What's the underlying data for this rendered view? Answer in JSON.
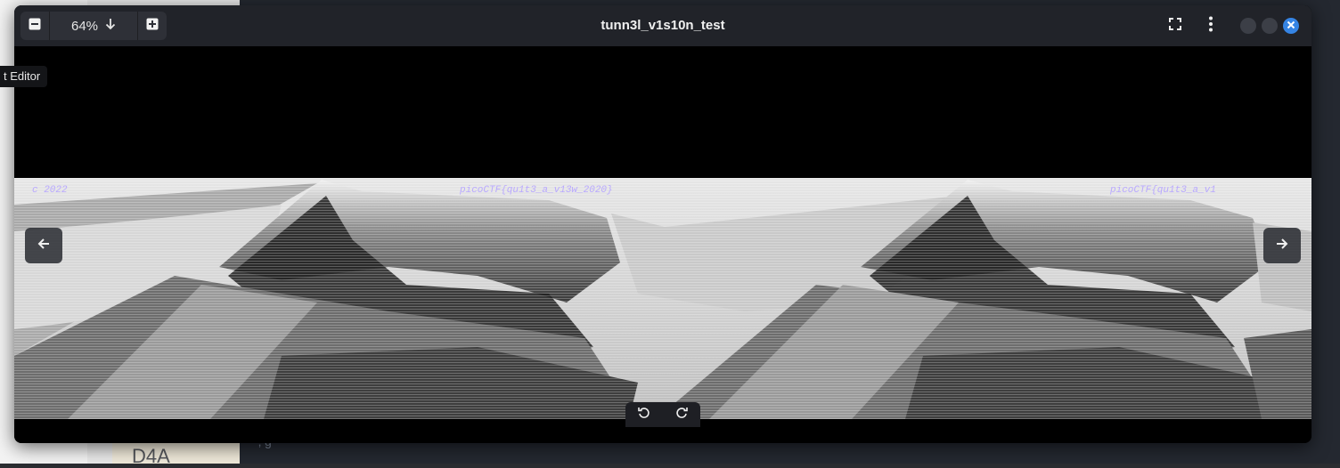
{
  "background": {
    "tooltip": "t Editor",
    "fragment_text": "D4A",
    "fragment_small": "‚  g"
  },
  "viewer": {
    "title": "tunn3l_v1s10n_test",
    "zoom": {
      "value": "64%",
      "zoom_out_icon": "minus-icon",
      "zoom_in_icon": "plus-icon",
      "dropdown_icon": "arrow-down-icon"
    },
    "header_icons": [
      "fullscreen-icon",
      "more-vertical-icon"
    ],
    "window_controls": [
      "minimize",
      "maximize",
      "close"
    ],
    "image": {
      "watermark_left": "c 2022",
      "watermark_mid": "picoCTF{qu1t3_a_v13w_2020}",
      "watermark_right": "picoCTF{qu1t3_a_v1"
    },
    "nav": {
      "prev_icon": "arrow-left-icon",
      "next_icon": "arrow-right-icon"
    },
    "rotate": {
      "left_icon": "rotate-left-icon",
      "right_icon": "rotate-right-icon"
    },
    "colors": {
      "accent": "#3584e4",
      "header": "#212329",
      "canvas": "#000000"
    }
  }
}
